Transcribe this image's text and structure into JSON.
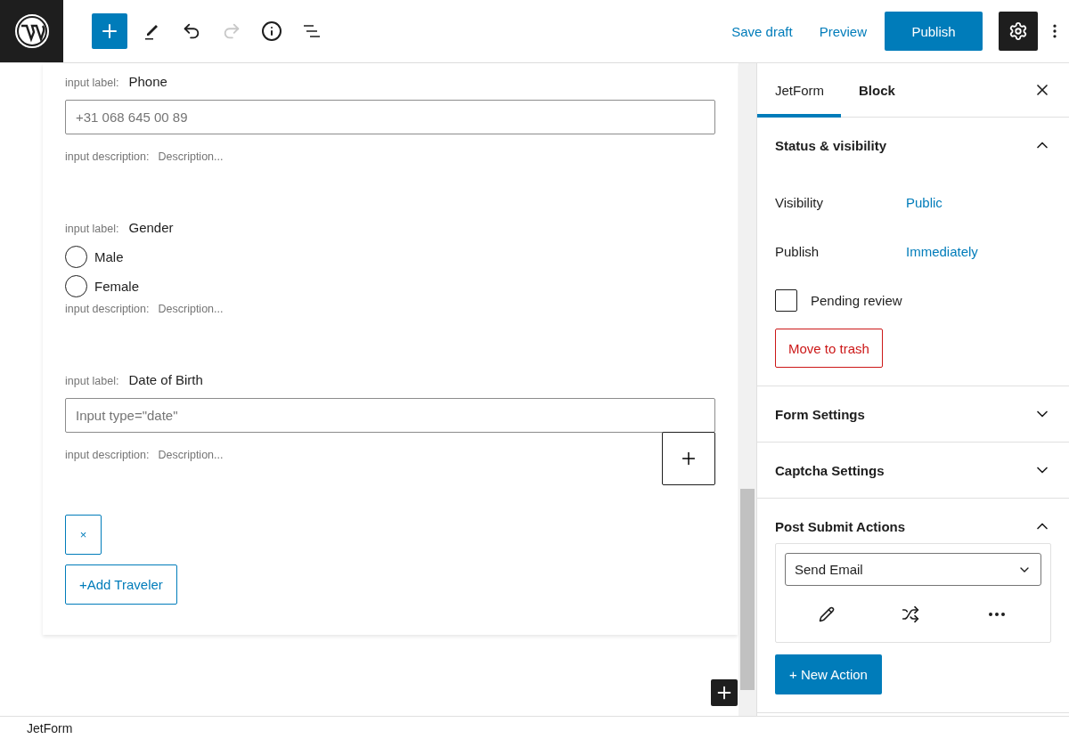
{
  "toolbar": {
    "save_draft": "Save draft",
    "preview": "Preview",
    "publish": "Publish",
    "redo_disabled": true
  },
  "form": {
    "fields": [
      {
        "kind": "text",
        "label_prefix": "input label:",
        "label": "Phone",
        "placeholder": "+31 068 645 00 89",
        "description_prefix": "input description:",
        "description": "Description..."
      },
      {
        "kind": "radio",
        "label_prefix": "input label:",
        "label": "Gender",
        "options": [
          {
            "label": "Male",
            "selected": false
          },
          {
            "label": "Female",
            "selected": false
          }
        ],
        "description_prefix": "input description:",
        "description": "Description..."
      },
      {
        "kind": "text",
        "label_prefix": "input label:",
        "label": "Date of Birth",
        "placeholder": "Input type=\"date\"",
        "description_prefix": "input description:",
        "description": "Description..."
      }
    ],
    "remove_button": "×",
    "add_button": "+Add Traveler"
  },
  "sidebar": {
    "tabs": [
      {
        "label": "JetForm",
        "selected": true
      },
      {
        "label": "Block",
        "selected": false
      }
    ],
    "panels": [
      {
        "kind": "status",
        "title": "Status & visibility",
        "expanded": true,
        "rows": [
          {
            "label": "Visibility",
            "value": "Public"
          },
          {
            "label": "Publish",
            "value": "Immediately"
          }
        ],
        "checkbox": {
          "label": "Pending review",
          "checked": false
        },
        "trash_button": "Move to trash"
      },
      {
        "kind": "plain",
        "title": "Form Settings",
        "expanded": false
      },
      {
        "kind": "plain",
        "title": "Captcha Settings",
        "expanded": false
      },
      {
        "kind": "actions",
        "title": "Post Submit Actions",
        "expanded": true,
        "action_select": "Send Email",
        "new_action": "+ New Action"
      }
    ]
  },
  "footer": {
    "breadcrumb": "JetForm"
  }
}
